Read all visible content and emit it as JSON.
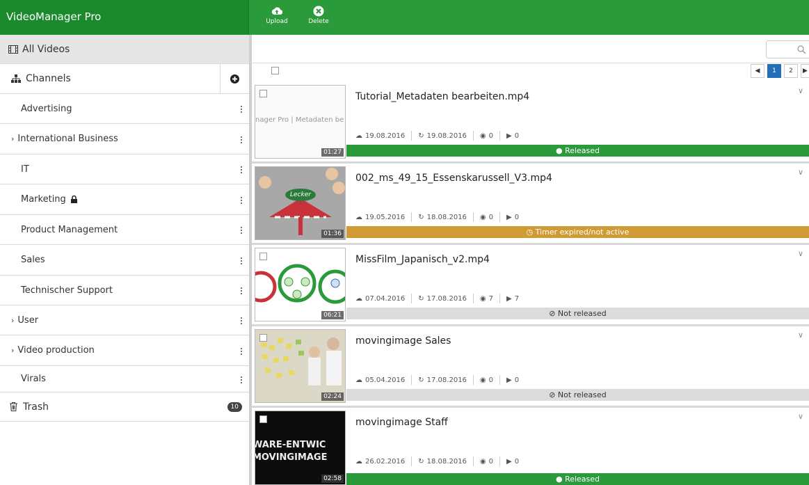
{
  "app": {
    "title": "VideoManager Pro"
  },
  "toolbar": {
    "upload_label": "Upload",
    "delete_label": "Delete"
  },
  "sidebar": {
    "all_videos": "All Videos",
    "channels": "Channels",
    "channel_items": [
      {
        "label": "Advertising",
        "expandable": false,
        "locked": false
      },
      {
        "label": "International Business",
        "expandable": true,
        "locked": false
      },
      {
        "label": "IT",
        "expandable": false,
        "locked": false
      },
      {
        "label": "Marketing",
        "expandable": false,
        "locked": true
      },
      {
        "label": "Product Management",
        "expandable": false,
        "locked": false
      },
      {
        "label": "Sales",
        "expandable": false,
        "locked": false
      },
      {
        "label": "Technischer Support",
        "expandable": false,
        "locked": false
      },
      {
        "label": "User",
        "expandable": true,
        "locked": false
      },
      {
        "label": "Video production",
        "expandable": true,
        "locked": false
      },
      {
        "label": "Virals",
        "expandable": false,
        "locked": false
      }
    ],
    "trash": "Trash",
    "trash_count": "10"
  },
  "pager": {
    "pages": [
      "1",
      "2"
    ],
    "current": "1"
  },
  "videos": [
    {
      "title": "Tutorial_Metadaten bearbeiten.mp4",
      "thumb_text": "nager Pro | Metadaten be",
      "duration": "01:27",
      "created": "19.08.2016",
      "modified": "19.08.2016",
      "views": "0",
      "plays": "0",
      "status": "Released"
    },
    {
      "title": "002_ms_49_15_Essenskarussell_V3.mp4",
      "thumb_text": "Lecker",
      "duration": "01:36",
      "created": "19.05.2016",
      "modified": "18.08.2016",
      "views": "0",
      "plays": "0",
      "status": "Timer expired/not active"
    },
    {
      "title": "MissFilm_Japanisch_v2.mp4",
      "thumb_text": "",
      "duration": "06:21",
      "created": "07.04.2016",
      "modified": "17.08.2016",
      "views": "7",
      "plays": "7",
      "status": "Not released"
    },
    {
      "title": "movingimage Sales",
      "thumb_text": "",
      "duration": "02:24",
      "created": "05.04.2016",
      "modified": "17.08.2016",
      "views": "0",
      "plays": "0",
      "status": "Not released"
    },
    {
      "title": "movingimage Staff",
      "thumb_text": "WARE-ENTWIC MOVINGIMAGE",
      "duration": "02:58",
      "created": "26.02.2016",
      "modified": "18.08.2016",
      "views": "0",
      "plays": "0",
      "status": "Released"
    }
  ],
  "colors": {
    "brand_green": "#2a9a3a",
    "expired_orange": "#d09a35",
    "active_page": "#2470b8"
  }
}
